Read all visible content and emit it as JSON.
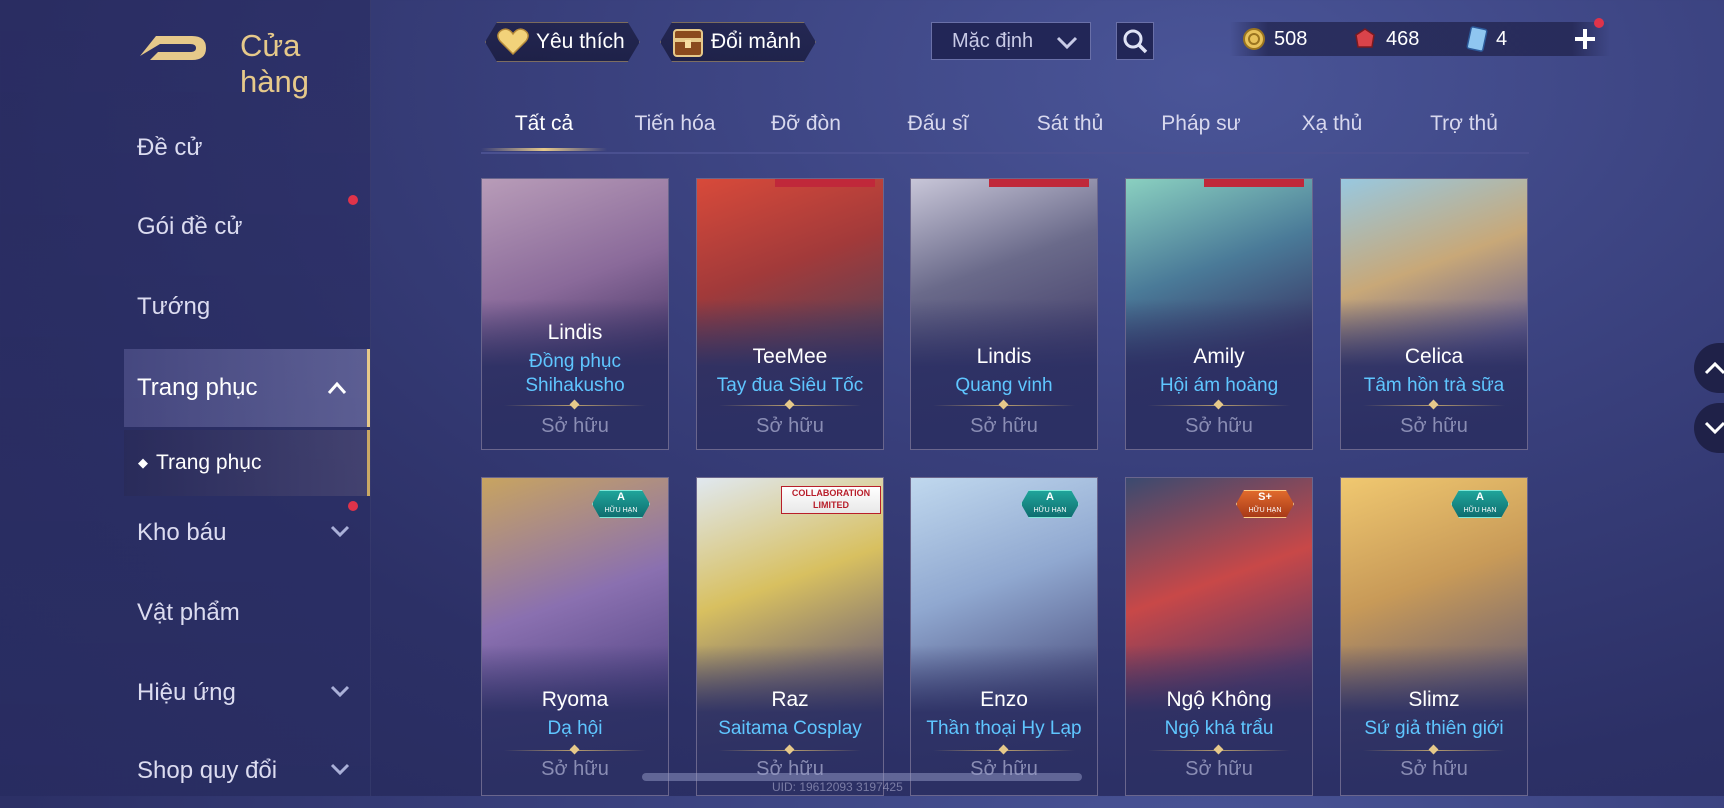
{
  "header": {
    "title": "Cửa hàng",
    "favorites_label": "Yêu thích",
    "exchange_label": "Đổi mảnh",
    "sort_value": "Mặc định"
  },
  "currency": {
    "gold": "508",
    "vouchers": "468",
    "tickets": "4"
  },
  "sidebar": {
    "items": [
      {
        "label": "Đề cử"
      },
      {
        "label": "Gói đề cử"
      },
      {
        "label": "Tướng"
      },
      {
        "label": "Trang phục"
      },
      {
        "label": "Trang phục"
      },
      {
        "label": "Kho báu"
      },
      {
        "label": "Vật phẩm"
      },
      {
        "label": "Hiệu ứng"
      },
      {
        "label": "Shop quy đổi"
      }
    ]
  },
  "tabs": [
    "Tất cả",
    "Tiến hóa",
    "Đỡ đòn",
    "Đấu sĩ",
    "Sát thủ",
    "Pháp sư",
    "Xạ thủ",
    "Trợ thủ"
  ],
  "cards": [
    {
      "hero": "Lindis",
      "skin": "Đồng phục Shihakusho",
      "status": "Sở hữu"
    },
    {
      "hero": "TeeMee",
      "skin": "Tay đua Siêu Tốc",
      "status": "Sở hữu"
    },
    {
      "hero": "Lindis",
      "skin": "Quang vinh",
      "status": "Sở hữu"
    },
    {
      "hero": "Amily",
      "skin": "Hội ám hoàng",
      "status": "Sở hữu"
    },
    {
      "hero": "Celica",
      "skin": "Tâm hồn trà sữa",
      "status": "Sở hữu"
    },
    {
      "hero": "Ryoma",
      "skin": "Dạ hội",
      "status": "Sở hữu",
      "badge": "A",
      "badge_sub": "HỮU HẠN"
    },
    {
      "hero": "Raz",
      "skin": "Saitama Cosplay",
      "status": "Sở hữu",
      "collab": "COLLABORATION LIMITED"
    },
    {
      "hero": "Enzo",
      "skin": "Thần thoại Hy Lạp",
      "status": "Sở hữu",
      "badge": "A",
      "badge_sub": "HỮU HẠN"
    },
    {
      "hero": "Ngộ Không",
      "skin": "Ngộ khá trẩu",
      "status": "Sở hữu",
      "badge": "S+",
      "badge_sub": "HỮU HẠN"
    },
    {
      "hero": "Slimz",
      "skin": "Sứ giả thiên giới",
      "status": "Sở hữu",
      "badge": "A",
      "badge_sub": "HỮU HẠN"
    }
  ],
  "uid": "UID: 19612093 3197425",
  "colors": {
    "accent_gold": "#e6c98a",
    "skin_blue": "#5fc6ff",
    "notification_red": "#e0334a"
  }
}
